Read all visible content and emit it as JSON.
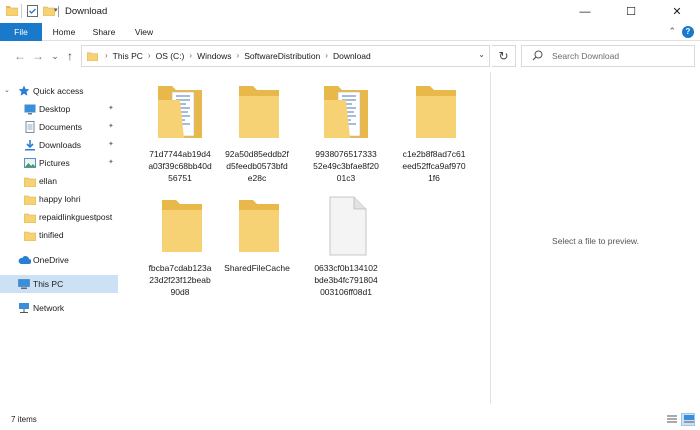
{
  "window": {
    "title": "Download",
    "minimize": "—",
    "maximize": "☐",
    "close": "✕"
  },
  "ribbon": {
    "tabs": [
      "File",
      "Home",
      "Share",
      "View"
    ],
    "help": "?",
    "collapse": "⌃"
  },
  "nav": {
    "back": "←",
    "forward": "→",
    "recent": "⌄",
    "up": "↑",
    "breadcrumb": [
      "This PC",
      "OS (C:)",
      "Windows",
      "SoftwareDistribution",
      "Download"
    ],
    "refresh": "↻",
    "search_placeholder": "Search Download"
  },
  "sidebar": {
    "items": [
      {
        "label": "Quick access",
        "icon": "star-icon",
        "pinned": false
      },
      {
        "label": "Desktop",
        "icon": "desktop-icon",
        "pinned": true
      },
      {
        "label": "Documents",
        "icon": "documents-icon",
        "pinned": true
      },
      {
        "label": "Downloads",
        "icon": "downloads-icon",
        "pinned": true
      },
      {
        "label": "Pictures",
        "icon": "pictures-icon",
        "pinned": true
      },
      {
        "label": "ellan",
        "icon": "folder-icon",
        "pinned": false
      },
      {
        "label": "happy lohri",
        "icon": "folder-icon",
        "pinned": false
      },
      {
        "label": "repaidlinkguestpost",
        "icon": "folder-icon",
        "pinned": false
      },
      {
        "label": "tinified",
        "icon": "folder-icon",
        "pinned": false
      },
      {
        "label": "OneDrive",
        "icon": "cloud-icon",
        "pinned": false
      },
      {
        "label": "This PC",
        "icon": "computer-icon",
        "pinned": false
      },
      {
        "label": "Network",
        "icon": "network-icon",
        "pinned": false
      }
    ],
    "pin_glyph": "📌"
  },
  "files": [
    {
      "name": "71d7744ab19d4a03f39c68bb40d56751",
      "type": "folder-with-files"
    },
    {
      "name": "92a50d85eddb2fd5feedb0573bfde28c",
      "type": "folder"
    },
    {
      "name": "993807651733352e49c3bfae8f2001c3",
      "type": "folder-with-files"
    },
    {
      "name": "c1e2b8f8ad7c61eed52ffca9af9701f6",
      "type": "folder"
    },
    {
      "name": "fbcba7cdab123a23d2f23f12beab90d8",
      "type": "folder"
    },
    {
      "name": "SharedFileCache",
      "type": "folder"
    },
    {
      "name": "0633cf0b134102bde3b4fc791804003106ff08d1",
      "type": "file"
    }
  ],
  "file_labels": [
    [
      "71d7744ab19d4",
      "a03f39c68bb40d",
      "56751"
    ],
    [
      "92a50d85eddb2f",
      "d5feedb0573bfd",
      "e28c"
    ],
    [
      "9938076517333",
      "52e49c3bfae8f20",
      "01c3"
    ],
    [
      "c1e2b8f8ad7c61",
      "eed52ffca9af970",
      "1f6"
    ],
    [
      "fbcba7cdab123a",
      "23d2f23f12beab",
      "90d8"
    ],
    [
      "SharedFileCache"
    ],
    [
      "0633cf0b134102",
      "bde3b4fc791804",
      "003106ff08d1"
    ]
  ],
  "preview": {
    "message": "Select a file to preview."
  },
  "status": {
    "items_count": "7 items"
  },
  "colors": {
    "accent": "#1979ca",
    "selected": "#cce1f5",
    "folder": "#f6d275",
    "folder_dark": "#e8b84a"
  }
}
